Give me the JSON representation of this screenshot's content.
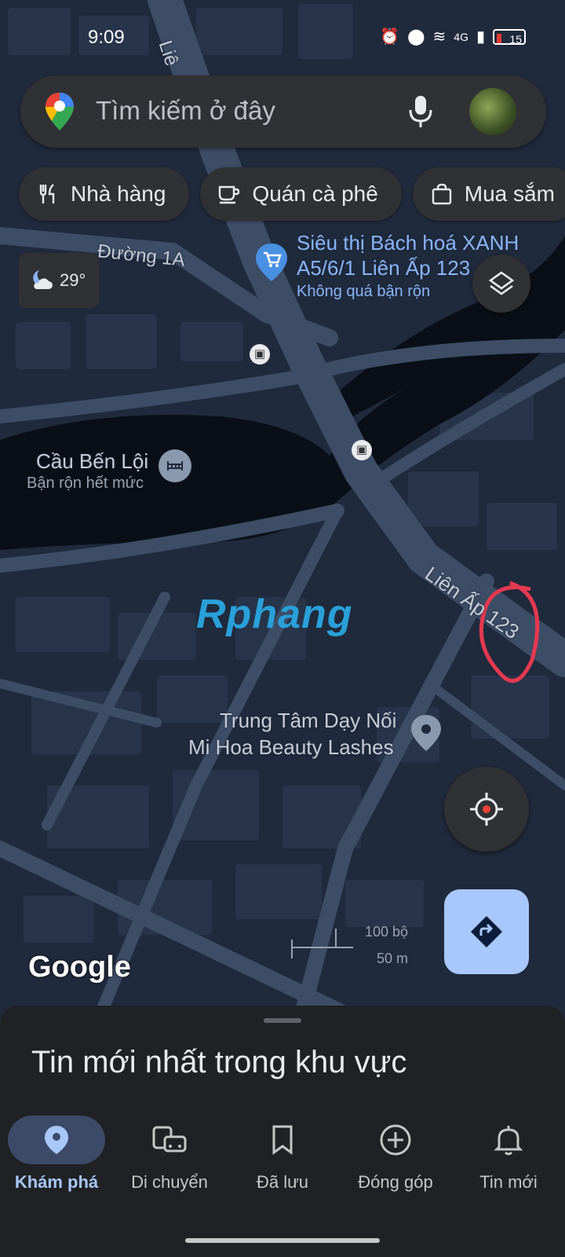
{
  "status_bar": {
    "time": "9:09",
    "network": "4G",
    "battery": "15"
  },
  "search": {
    "placeholder": "Tìm kiếm ở đây"
  },
  "chips": [
    {
      "label": "Nhà hàng",
      "icon": "restaurant-icon"
    },
    {
      "label": "Quán cà phê",
      "icon": "coffee-icon"
    },
    {
      "label": "Mua sắm",
      "icon": "shopping-bag-icon"
    }
  ],
  "weather": {
    "temperature": "29°",
    "icon": "night-cloudy-icon"
  },
  "map_labels": {
    "street_duong_1a": "Đường 1A",
    "street_lien_ap_123": "Liên Ấp 123",
    "street_lien_top": "Liê",
    "poi_store_name": "Siêu thị Bách hoá XANH",
    "poi_store_address": "A5/6/1 Liên Ấp 123",
    "poi_store_status": "Không quá bận rộn",
    "poi_bridge_name": "Cầu Bến Lội",
    "poi_bridge_status": "Bận rộn hết mức",
    "poi_beauty_line1": "Trung Tâm Dạy Nối",
    "poi_beauty_line2": "Mi Hoa Beauty Lashes",
    "watermark": "Rphang"
  },
  "map": {
    "google_logo": "Google",
    "scale_top": "100 bộ",
    "scale_bottom": "50 m"
  },
  "sheet": {
    "title": "Tin mới nhất trong khu vực"
  },
  "bottom_nav": [
    {
      "label": "Khám phá",
      "icon": "explore-pin-icon",
      "active": true
    },
    {
      "label": "Di chuyển",
      "icon": "commute-icon",
      "active": false
    },
    {
      "label": "Đã lưu",
      "icon": "bookmark-icon",
      "active": false
    },
    {
      "label": "Đóng góp",
      "icon": "add-circle-icon",
      "active": false
    },
    {
      "label": "Tin mới",
      "icon": "bell-icon",
      "active": false
    }
  ]
}
